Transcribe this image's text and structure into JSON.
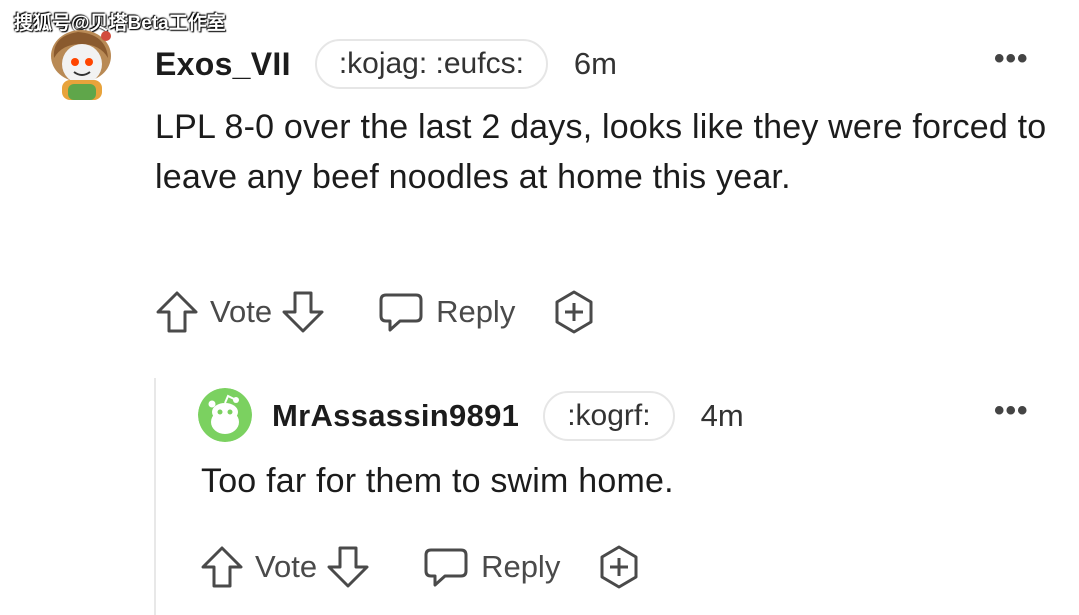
{
  "watermark": "搜狐号@贝塔Beta工作室",
  "comments": [
    {
      "username": "Exos_VII",
      "flair": ":kojag: :eufcs:",
      "time": "6m",
      "more": "•••",
      "text": "LPL 8-0 over the last 2 days, looks like they were forced to leave any beef noodles at home this year.",
      "vote_label": "Vote",
      "reply_label": "Reply"
    },
    {
      "username": "MrAssassin9891",
      "flair": ":kogrf:",
      "time": "4m",
      "more": "•••",
      "text": "Too far for them to swim home.",
      "vote_label": "Vote",
      "reply_label": "Reply"
    }
  ],
  "icons": {
    "upvote": "upvote-arrow-icon",
    "downvote": "downvote-arrow-icon",
    "reply": "speech-bubble-icon",
    "award": "award-plus-icon",
    "more": "more-dots-icon"
  },
  "colors": {
    "text": "#1c1c1c",
    "muted": "#4a4a4a",
    "avatar2_bg": "#7bd160"
  }
}
